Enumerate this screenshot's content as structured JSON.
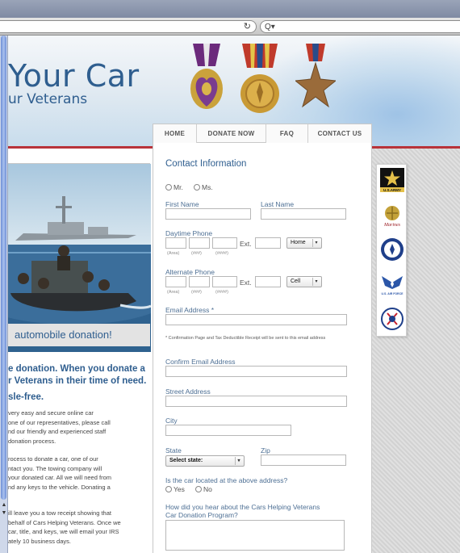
{
  "browser": {
    "reload_icon": "reload-icon",
    "search_icon": "search-icon",
    "search_glyph": "Q▾",
    "reload_glyph": "↻"
  },
  "header": {
    "title": "Your Car",
    "subtitle": "ur Veterans"
  },
  "nav": {
    "tabs": [
      {
        "label": "HOME"
      },
      {
        "label": "DONATE NOW"
      },
      {
        "label": "FAQ"
      },
      {
        "label": "CONTACT US"
      }
    ]
  },
  "left": {
    "photo_caption": "automobile donation!",
    "promo_line_1": "e donation. When you donate a",
    "promo_line_2": "r Veterans in their time of need.",
    "promo_line_3": "sle-free.",
    "para1": [
      "very easy and secure online car",
      "one of our representatives, please call",
      "nd our friendly and experienced staff",
      "donation process."
    ],
    "para2": [
      "rocess to donate a car, one of our",
      "ntact you. The towing company will",
      "your donated car. All we will need from",
      "nd any keys to the vehicle. Donating a"
    ],
    "para3": [
      "ill leave you a tow receipt showing that",
      "behalf of Cars Helping Veterans. Once we",
      "car, title, and keys, we will email your IRS",
      "ately 10 business days."
    ]
  },
  "form": {
    "section_title": "Contact Information",
    "salutation_mr": "Mr.",
    "salutation_ms": "Ms.",
    "first_name_label": "First Name",
    "last_name_label": "Last Name",
    "daytime_phone_label": "Daytime Phone",
    "ext_label": "Ext.",
    "phone_type_day": "Home",
    "area_hint": "(Area)",
    "prefix_hint": "(###)",
    "line_hint": "(####)",
    "alternate_phone_label": "Alternate Phone",
    "phone_type_alt": "Cell",
    "email_label": "Email Address *",
    "email_note": "* Confirmation Page and Tax Deductible Receipt will be sent to this email address",
    "confirm_email_label": "Confirm Email Address",
    "street_label": "Street Address",
    "city_label": "City",
    "state_label": "State",
    "state_select": "Select state:",
    "zip_label": "Zip",
    "located_question": "Is the car located at the above address?",
    "yes_label": "Yes",
    "no_label": "No",
    "hear_question_line1": "How did you hear about the Cars Helping Veterans",
    "hear_question_line2": "Car Donation Program?"
  },
  "badges": [
    {
      "name": "army-emblem-icon",
      "text": "U.S.ARMY"
    },
    {
      "name": "marines-emblem-icon",
      "text": "Marines"
    },
    {
      "name": "navy-emblem-icon",
      "text": ""
    },
    {
      "name": "air-force-emblem-icon",
      "text": "U.S. AIR FORCE"
    },
    {
      "name": "coast-guard-emblem-icon",
      "text": ""
    }
  ],
  "colors": {
    "accent_blue": "#2f5e8f",
    "rule_red": "#b8333a",
    "label_blue": "#4d6f94"
  }
}
